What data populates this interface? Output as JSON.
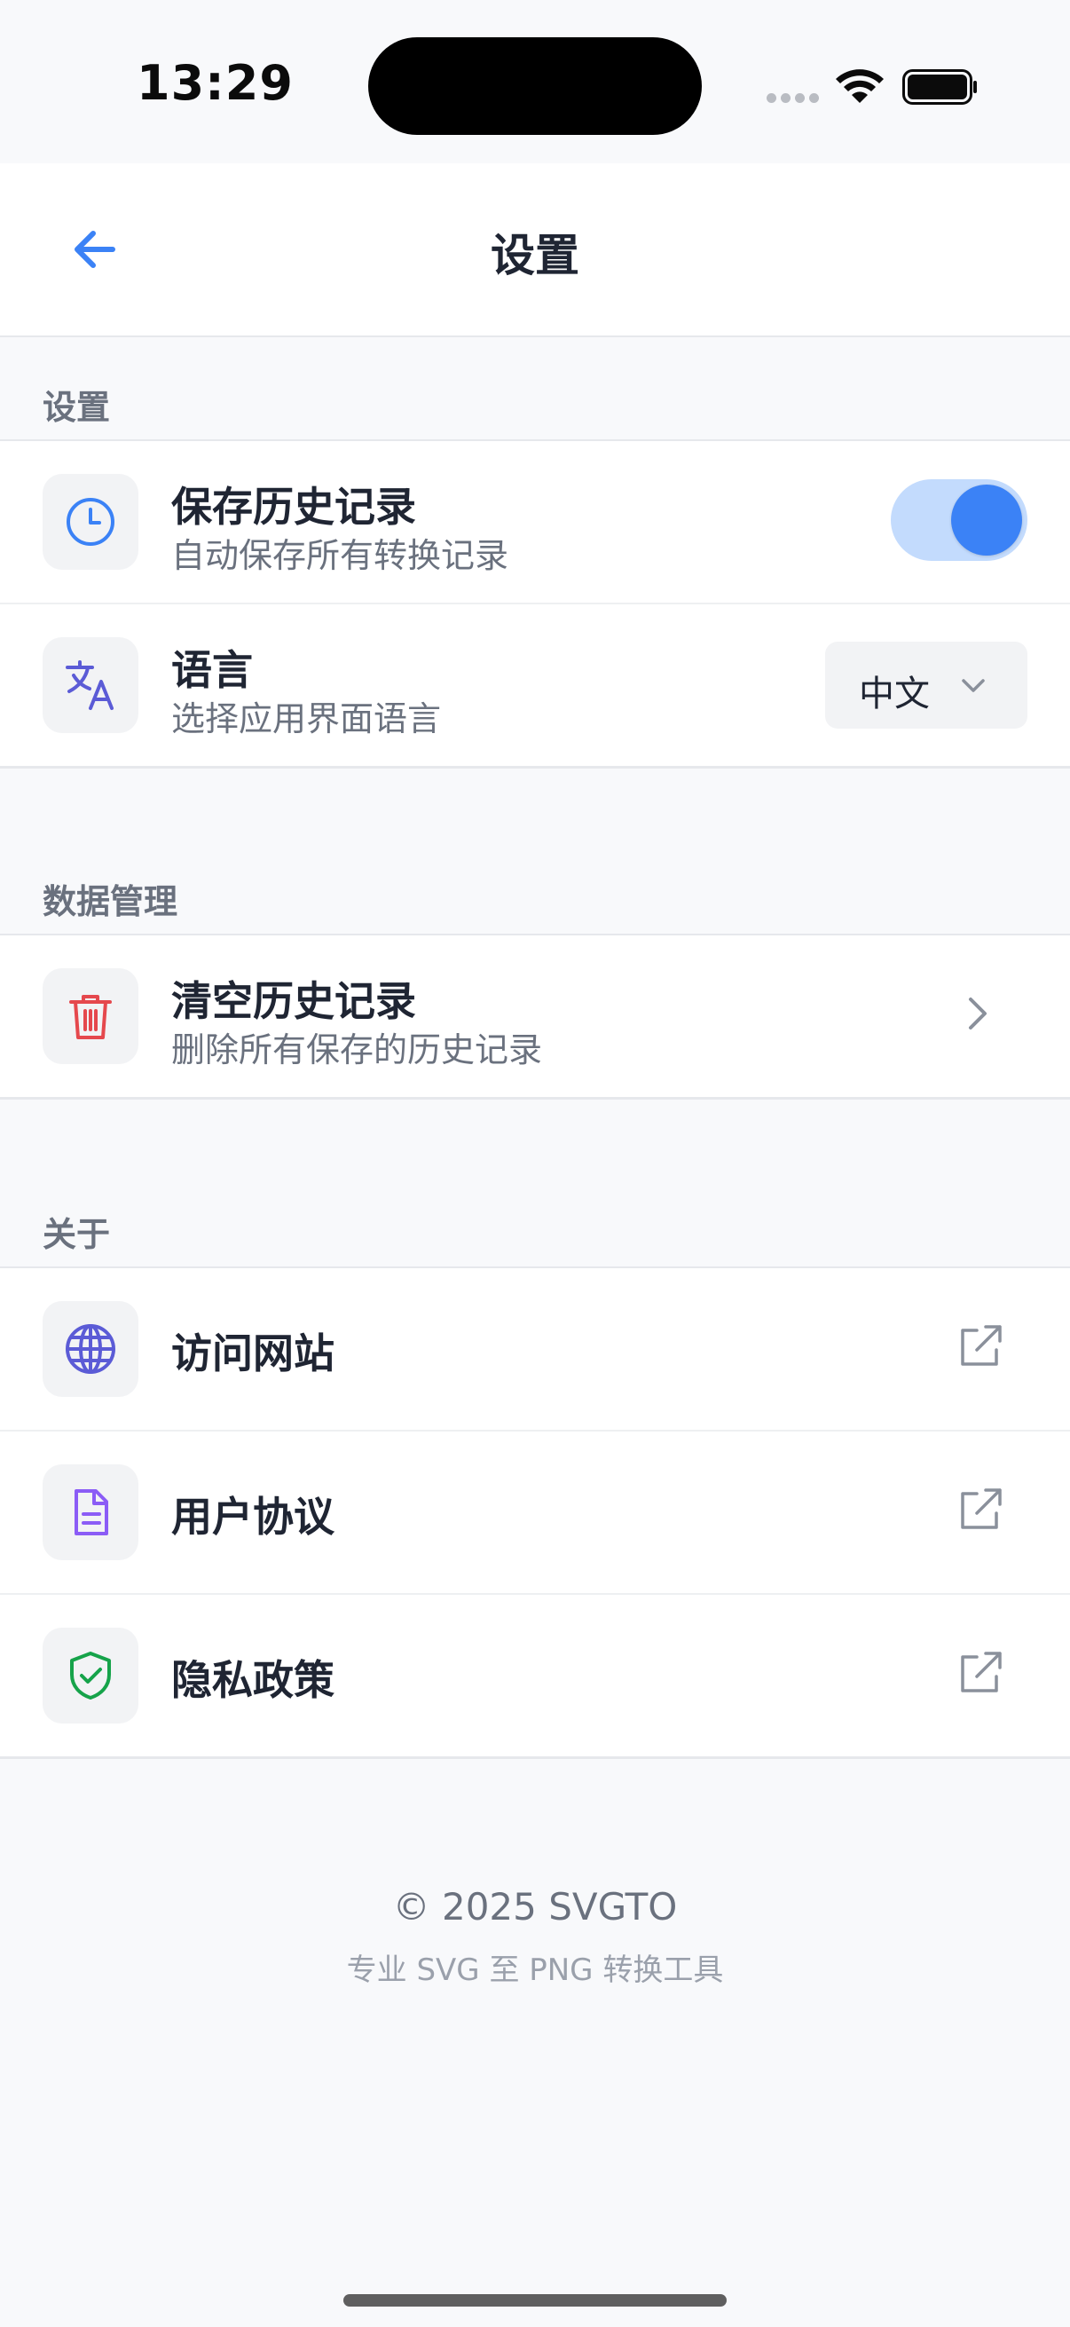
{
  "status_bar": {
    "time": "13:29"
  },
  "nav": {
    "title": "设置",
    "back_icon": "arrow-left-icon"
  },
  "sections": {
    "settings": {
      "label": "设置",
      "items": [
        {
          "title": "保存历史记录",
          "subtitle": "自动保存所有转换记录",
          "icon": "clock-icon",
          "toggle_on": true
        },
        {
          "title": "语言",
          "subtitle": "选择应用界面语言",
          "icon": "translate-icon",
          "selected_language": "中文"
        }
      ]
    },
    "data_management": {
      "label": "数据管理",
      "items": [
        {
          "title": "清空历史记录",
          "subtitle": "删除所有保存的历史记录",
          "icon": "trash-icon"
        }
      ]
    },
    "about": {
      "label": "关于",
      "items": [
        {
          "title": "访问网站",
          "icon": "globe-icon"
        },
        {
          "title": "用户协议",
          "icon": "document-icon"
        },
        {
          "title": "隐私政策",
          "icon": "shield-check-icon"
        }
      ]
    }
  },
  "footer": {
    "copyright": "© 2025 SVGTO",
    "tagline": "专业 SVG 至 PNG 转换工具"
  },
  "colors": {
    "accent": "#3b82f6",
    "toggle_track": "#c3dbfd",
    "danger": "#e5484d",
    "globe": "#5b5bd6",
    "document": "#8b5cf6",
    "shield": "#16a34a",
    "background": "#f8f9fb"
  }
}
